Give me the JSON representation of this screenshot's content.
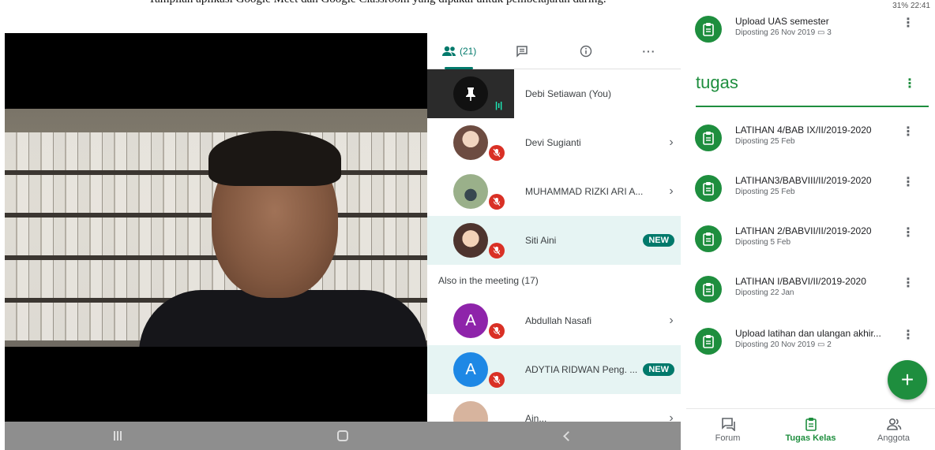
{
  "caption": {
    "text": "Tampilan aplikasi Google Meet dan Google Classroom yang dipakai untuk pembelajaran daring."
  },
  "status_bar": {
    "text": "31% 22:41"
  },
  "meet": {
    "tabs": [
      {
        "icon": "people-icon",
        "count": "(21)"
      },
      {
        "icon": "chat-icon"
      },
      {
        "icon": "info-icon"
      },
      {
        "icon": "more-icon",
        "label": "···"
      }
    ],
    "participants": [
      {
        "name": "Debi Setiawan (You)",
        "initial": "",
        "avatar_color": "#111111",
        "self": true
      },
      {
        "name": "Devi Sugianti",
        "initial": "",
        "avatar_color": "#8d6e63",
        "muted": true
      },
      {
        "name": "MUHAMMAD RIZKI ARI A...",
        "initial": "",
        "avatar_color": "#7c8f6a",
        "muted": true
      },
      {
        "name": "Siti Aini",
        "initial": "",
        "avatar_color": "#c9a27e",
        "muted": true,
        "badge": "NEW"
      }
    ],
    "section_label": "Also in the meeting (17)",
    "others": [
      {
        "name": "Abdullah Nasafi",
        "initial": "A",
        "avatar_color": "#8e24aa",
        "muted": true
      },
      {
        "name": "ADYTIA RIDWAN Peng. ...",
        "initial": "A",
        "avatar_color": "#1e88e5",
        "muted": true,
        "badge": "NEW"
      },
      {
        "name": "Ain...",
        "initial": "",
        "avatar_color": "#d7b49e"
      }
    ]
  },
  "classroom": {
    "top_item": {
      "title": "Upload UAS semester",
      "meta": "Diposting 26 Nov 2019",
      "comments": "3"
    },
    "topic": "tugas",
    "items": [
      {
        "title": "LATIHAN 4/BAB IX/II/2019-2020",
        "meta": "Diposting 25 Feb"
      },
      {
        "title": "LATIHAN3/BABVIII/II/2019-2020",
        "meta": "Diposting 25 Feb"
      },
      {
        "title": "LATIHAN 2/BABVII/II/2019-2020",
        "meta": "Diposting 5 Feb"
      },
      {
        "title": "LATIHAN I/BABVI/II/2019-2020",
        "meta": "Diposting 22 Jan"
      },
      {
        "title": "Upload latihan dan ulangan akhir...",
        "meta": "Diposting 20 Nov 2019",
        "comments": "2"
      }
    ],
    "fab_label": "+",
    "bottom_nav": [
      {
        "label": "Forum",
        "icon": "forum-icon"
      },
      {
        "label": "Tugas Kelas",
        "icon": "classwork-icon",
        "active": true
      },
      {
        "label": "Anggota",
        "icon": "people-icon"
      }
    ],
    "colors": {
      "accent": "#1e8e3e",
      "meet_accent": "#00796b",
      "mute": "#d93025"
    }
  }
}
